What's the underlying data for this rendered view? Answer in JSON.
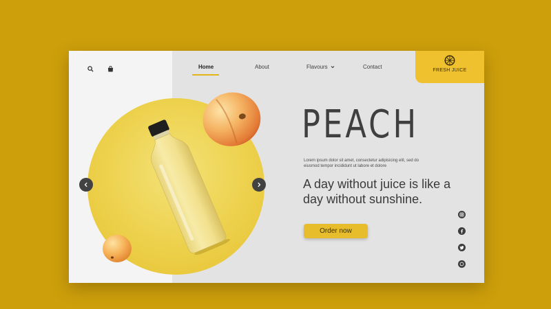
{
  "header": {
    "icons": [
      "search-icon",
      "shopping-bag-icon"
    ],
    "nav": [
      {
        "label": "Home"
      },
      {
        "label": "About"
      },
      {
        "label": "Flavours"
      },
      {
        "label": "Contact"
      }
    ],
    "active_nav": "Home",
    "brand": {
      "name": "FRESH JUICE"
    }
  },
  "hero": {
    "title": "PEACH",
    "lorem": "Lorem ipsum dolor sit amet, consectetur adipisicing elit, sed do eiusmod tempor incididunt ut labore et dolore",
    "tagline": "A day without juice is like a day without sunshine.",
    "cta_label": "Order now"
  },
  "carousel": {
    "prev_icon": "chevron-left-icon",
    "next_icon": "chevron-right-icon"
  },
  "social": [
    "instagram-icon",
    "facebook-icon",
    "twitter-icon",
    "whatsapp-icon"
  ],
  "colors": {
    "background": "#cd9f0b",
    "accent": "#efc12f",
    "circle": "#eed453",
    "text": "#3f3f3f"
  }
}
